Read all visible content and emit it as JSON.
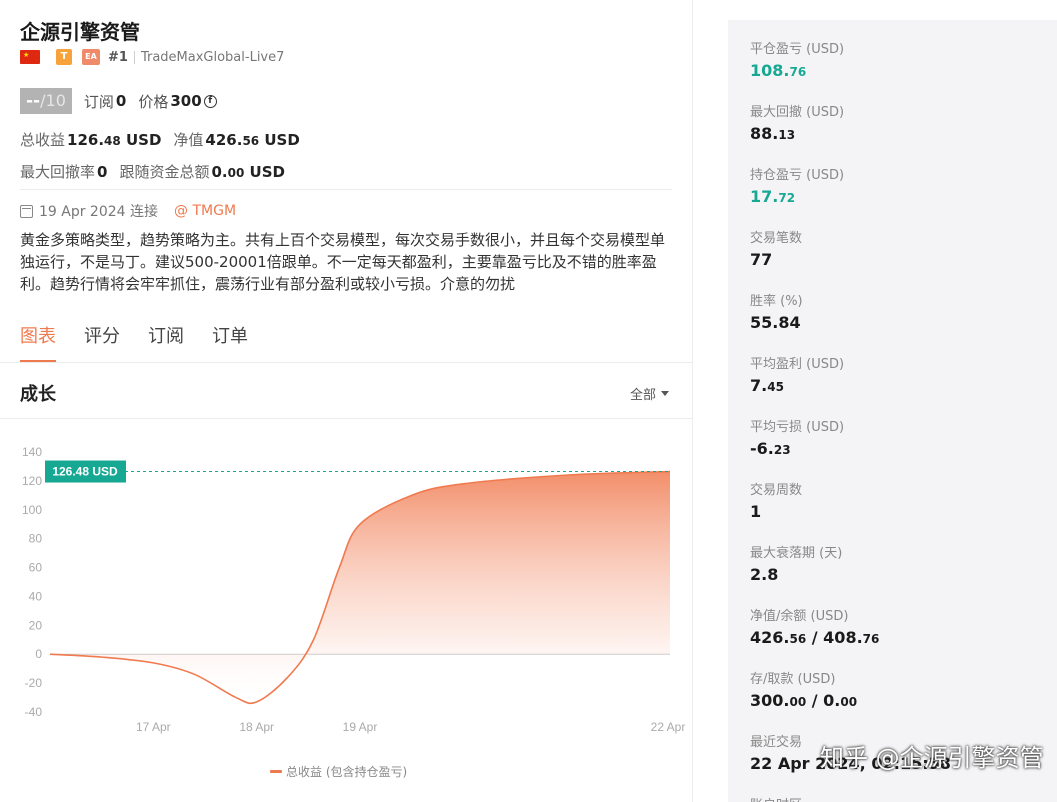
{
  "header": {
    "title": "企源引擎资管",
    "badge_t": "T",
    "badge_ea": "EA",
    "rank": "#1",
    "account": "TradeMaxGlobal-Live7"
  },
  "score": {
    "value": "--",
    "max": "/10",
    "subscribe_label": "订阅",
    "subscribe_value": "0",
    "price_label": "价格",
    "price_value": "300",
    "coin_symbol": "f"
  },
  "stats": {
    "total_profit_label": "总收益",
    "total_profit_int": "126.",
    "total_profit_dec": "48",
    "total_profit_unit": "USD",
    "equity_label": "净值",
    "equity_int": "426.",
    "equity_dec": "56",
    "equity_unit": "USD",
    "max_dd_label": "最大回撤率",
    "max_dd_value": "0",
    "follow_label": "跟随资金总额",
    "follow_int": "0.",
    "follow_dec": "00",
    "follow_unit": "USD"
  },
  "info": {
    "date": "19 Apr 2024 连接",
    "broker": "@ TMGM",
    "description": "黄金多策略类型，趋势策略为主。共有上百个交易模型，每次交易手数很小，并且每个交易模型单独运行，不是马丁。建议500-20001倍跟单。不一定每天都盈利，主要靠盈亏比及不错的胜率盈利。趋势行情将会牢牢抓住，震荡行业有部分盈利或较小亏损。介意的勿扰"
  },
  "tabs": [
    "图表",
    "评分",
    "订阅",
    "订单"
  ],
  "chart_section": {
    "title": "成长",
    "range": "全部"
  },
  "chart_data": {
    "type": "area",
    "title": "成长",
    "x": [
      "16 Apr",
      "16.5 Apr",
      "17 Apr",
      "17.5 Apr",
      "17.9 Apr",
      "18 Apr",
      "18.3 Apr",
      "18.5 Apr",
      "18.8 Apr",
      "19 Apr",
      "19.5 Apr",
      "20 Apr",
      "21 Apr",
      "22 Apr"
    ],
    "x_pos": [
      16.0,
      16.5,
      17.0,
      17.4,
      17.8,
      18.0,
      18.3,
      18.55,
      18.8,
      19.0,
      19.5,
      20.0,
      21.0,
      22.0
    ],
    "y": [
      0,
      -2,
      -6,
      -14,
      -30,
      -33,
      -16,
      10,
      60,
      90,
      110,
      118,
      124,
      126.48
    ],
    "x_ticks": [
      "17 Apr",
      "18 Apr",
      "19 Apr",
      "22 Apr"
    ],
    "y_ticks": [
      140,
      120,
      100,
      80,
      60,
      40,
      20,
      0,
      -20,
      -40
    ],
    "ylim": [
      -40,
      140
    ],
    "current_label": "126.48 USD",
    "series": [
      {
        "name": "总收益 (包含持仓盈亏)",
        "color": "#f07a4f"
      }
    ]
  },
  "metrics": [
    {
      "label": "平仓盈亏 (USD)",
      "int": "108.",
      "dec": "76",
      "green": true
    },
    {
      "label": "最大回撤 (USD)",
      "int": "88.",
      "dec": "13"
    },
    {
      "label": "持仓盈亏 (USD)",
      "int": "17.",
      "dec": "72",
      "green": true
    },
    {
      "label": "交易笔数",
      "int": "77",
      "dec": ""
    },
    {
      "label": "胜率 (%)",
      "int": "55.84",
      "dec": ""
    },
    {
      "label": "平均盈利 (USD)",
      "int": "7.",
      "dec": "45"
    },
    {
      "label": "平均亏损 (USD)",
      "int": "-6.",
      "dec": "23"
    },
    {
      "label": "交易周数",
      "int": "1",
      "dec": ""
    },
    {
      "label": "最大衰落期 (天)",
      "int": "2.8",
      "dec": ""
    },
    {
      "label": "净值/余额 (USD)",
      "int": "426.",
      "dec": "56",
      "extra_int": " / 408.",
      "extra_dec": "76"
    },
    {
      "label": "存/取款 (USD)",
      "int": "300.",
      "dec": "00",
      "extra_int": " / 0.",
      "extra_dec": "00"
    },
    {
      "label": "最近交易",
      "int": "22 Apr 2024, 02:15:58",
      "dec": ""
    },
    {
      "label": "账户时区",
      "int": "",
      "dec": ""
    }
  ],
  "watermark": "知乎 @企源引擎资管",
  "colors": {
    "accent": "#f07a4f",
    "green": "#17a894"
  }
}
